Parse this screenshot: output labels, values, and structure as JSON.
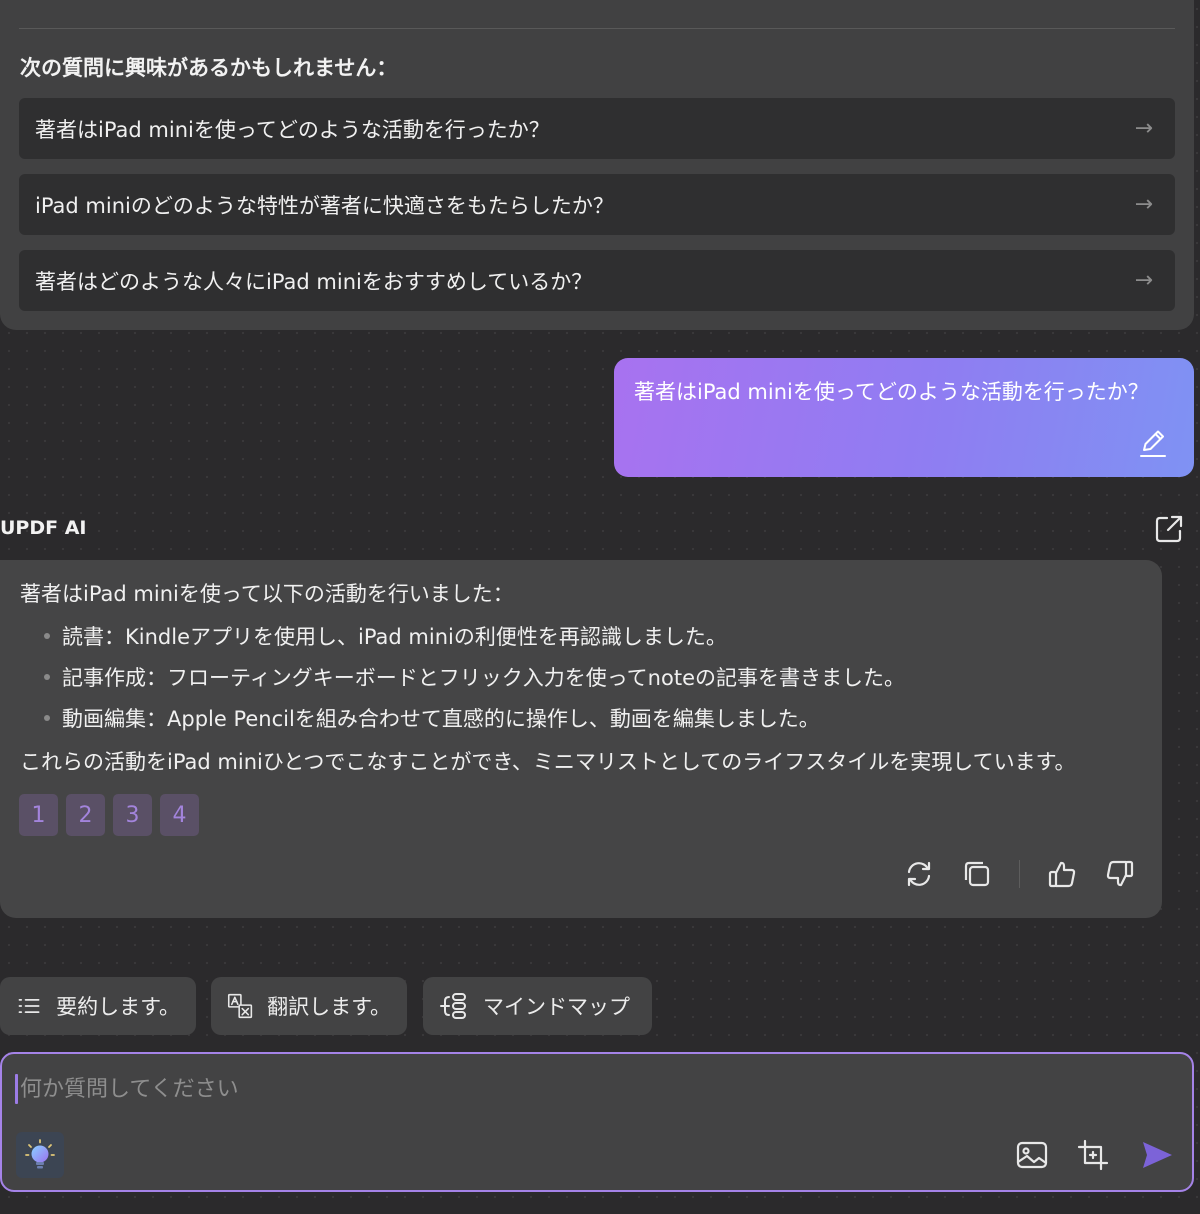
{
  "suggestions": {
    "heading": "次の質問に興味があるかもしれません：",
    "items": [
      {
        "text": "著者はiPad miniを使ってどのような活動を行ったか？",
        "arrow": "→"
      },
      {
        "text": "iPad miniのどのような特性が著者に快適さをもたらしたか？",
        "arrow": "→"
      },
      {
        "text": "著者はどのような人々にiPad miniをおすすめしているか？",
        "arrow": "→"
      }
    ]
  },
  "user_message": {
    "text": "著者はiPad miniを使ってどのような活動を行ったか？",
    "edit_icon": "pencil-icon",
    "gradient": [
      "#a872f0",
      "#7f92f3"
    ]
  },
  "ai": {
    "label": "UPDF AI",
    "export_icon": "external-link-icon",
    "intro": "著者はiPad miniを使って以下の活動を行いました：",
    "bullets": [
      "読書：Kindleアプリを使用し、iPad miniの利便性を再認識しました。",
      "記事作成：フローティングキーボードとフリック入力を使ってnoteの記事を書きました。",
      "動画編集：Apple Pencilを組み合わせて直感的に操作し、動画を編集しました。"
    ],
    "conclusion": "これらの活動をiPad miniひとつでこなすことができ、ミニマリストとしてのライフスタイルを実現しています。",
    "references": [
      "1",
      "2",
      "3",
      "4"
    ],
    "actions": [
      "regenerate-icon",
      "copy-icon",
      "thumbs-up-icon",
      "thumbs-down-icon"
    ]
  },
  "quick_actions": [
    {
      "label": "要約します。",
      "icon": "list-icon"
    },
    {
      "label": "翻訳します。",
      "icon": "translate-icon"
    },
    {
      "label": "マインドマップ",
      "icon": "mindmap-icon"
    }
  ],
  "input": {
    "placeholder": "何か質問してください",
    "accent": "#a583e8"
  },
  "colors": {
    "background": "#2b2a2c",
    "panel": "#414142",
    "card": "#454546",
    "reference_text": "#a384dc",
    "send": "#7c63d8"
  }
}
